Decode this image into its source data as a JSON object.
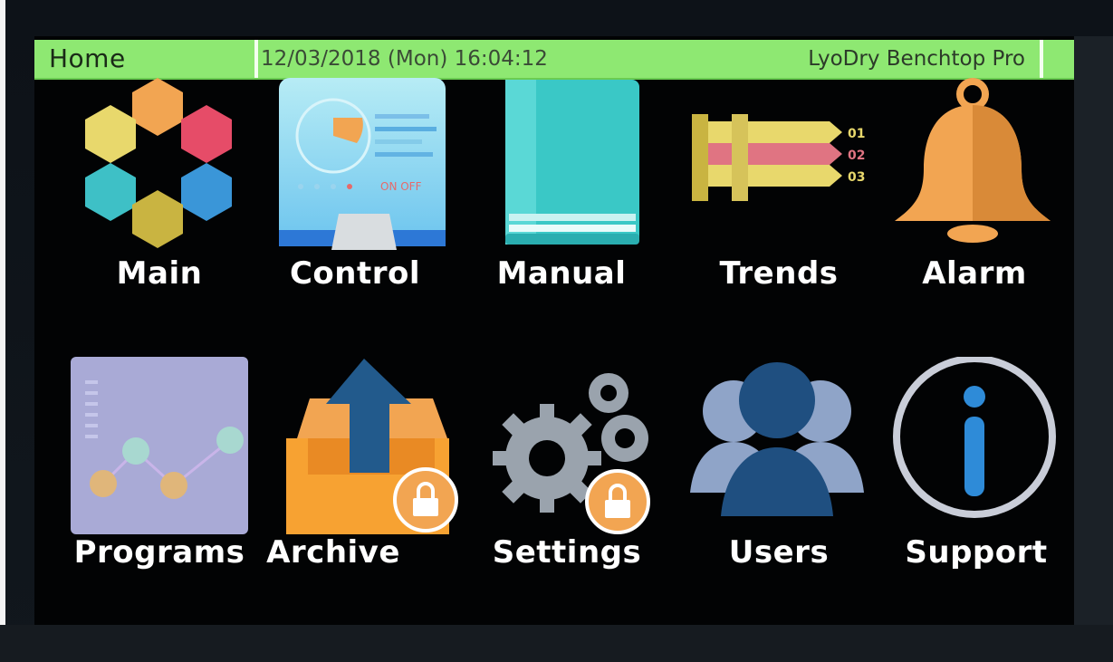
{
  "status_bar": {
    "title": "Home",
    "datetime": "12/03/2018 (Mon) 16:04:12",
    "product": "LyoDry Benchtop Pro",
    "color": "#8ee872"
  },
  "tiles": [
    {
      "label": "Main",
      "icon": "hexagon-ring-icon",
      "locked": false
    },
    {
      "label": "Control",
      "icon": "control-panel-icon",
      "locked": false
    },
    {
      "label": "Manual",
      "icon": "book-icon",
      "locked": false
    },
    {
      "label": "Trends",
      "icon": "trend-banners-icon",
      "locked": false
    },
    {
      "label": "Alarm",
      "icon": "bell-icon",
      "locked": false
    },
    {
      "label": "Programs",
      "icon": "program-chart-icon",
      "locked": false
    },
    {
      "label": "Archive",
      "icon": "archive-upload-icon",
      "locked": true
    },
    {
      "label": "Settings",
      "icon": "gears-icon",
      "locked": true
    },
    {
      "label": "Users",
      "icon": "users-icon",
      "locked": false
    },
    {
      "label": "Support",
      "icon": "info-icon",
      "locked": false
    }
  ],
  "trends_markers": [
    "01",
    "02",
    "03"
  ],
  "control_preview_text": "ON OFF"
}
